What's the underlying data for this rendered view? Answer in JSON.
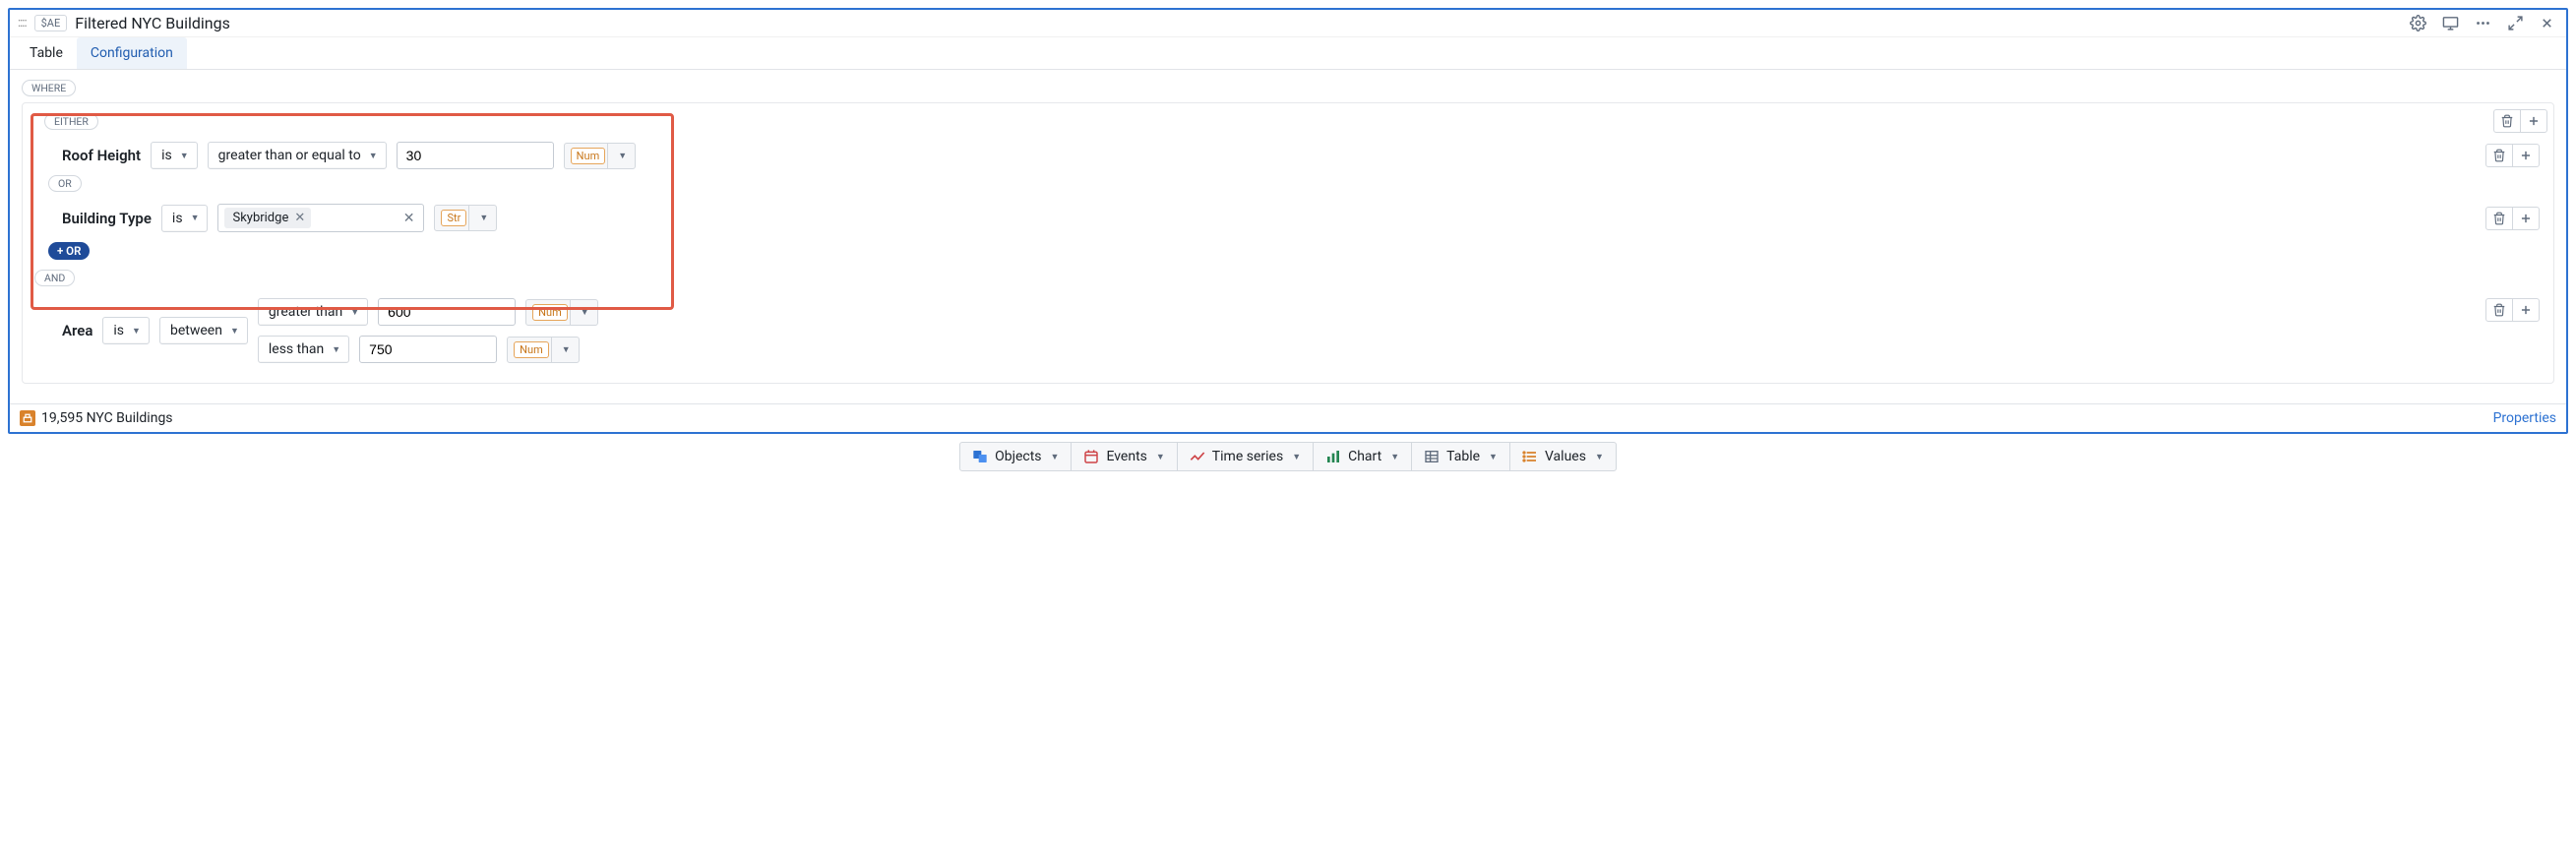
{
  "header": {
    "alias": "$AE",
    "title": "Filtered NYC Buildings"
  },
  "tabs": {
    "table": "Table",
    "configuration": "Configuration"
  },
  "clauses": {
    "where": "WHERE",
    "either": "EITHER",
    "or": "OR",
    "and": "AND",
    "add_or": "+ OR"
  },
  "conditions": {
    "roof_height": {
      "field": "Roof Height",
      "verb": "is",
      "operator": "greater than or equal to",
      "value": "30",
      "type": "Num"
    },
    "building_type": {
      "field": "Building Type",
      "verb": "is",
      "chip": "Skybridge",
      "type": "Str"
    },
    "area": {
      "field": "Area",
      "verb": "is",
      "operator": "between",
      "lower_op": "greater than",
      "lower_val": "600",
      "lower_type": "Num",
      "upper_op": "less than",
      "upper_val": "750",
      "upper_type": "Num"
    }
  },
  "footer": {
    "count_text": "19,595 NYC Buildings",
    "properties": "Properties"
  },
  "toolbar": {
    "objects": "Objects",
    "events": "Events",
    "time_series": "Time series",
    "chart": "Chart",
    "table": "Table",
    "values": "Values"
  }
}
